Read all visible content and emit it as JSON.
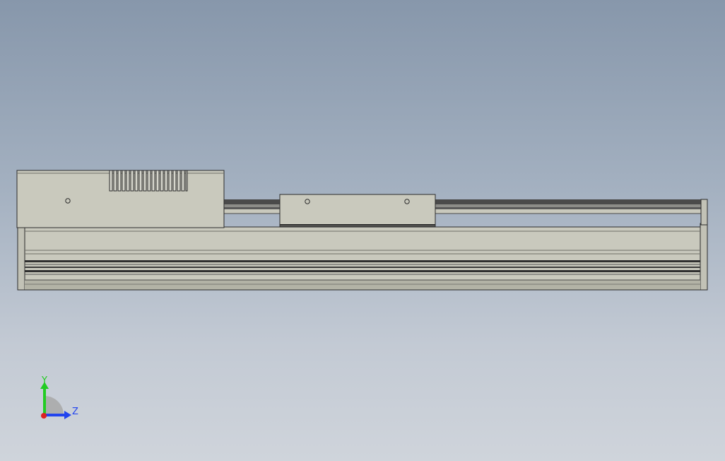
{
  "viewport": {
    "background_top": "#8797ab",
    "background_bottom": "#cfd4db"
  },
  "model": {
    "body_color": "#c9c9bd",
    "body_shade": "#b7b7aa",
    "edge_color": "#2b2b2b",
    "rail_dark": "#4a4a4a",
    "rail_light": "#8c8c88"
  },
  "triad": {
    "y_label": "Y",
    "z_label": "Z",
    "y_color": "#22cc22",
    "z_color": "#2244ee",
    "x_color": "#dd2222"
  }
}
